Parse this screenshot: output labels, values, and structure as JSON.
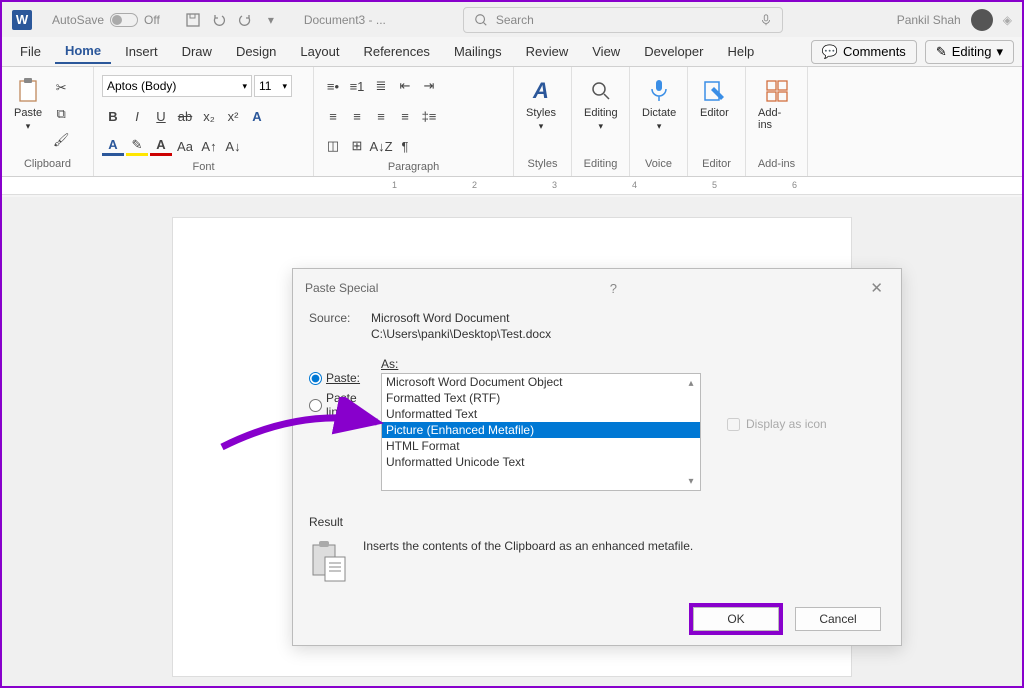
{
  "titlebar": {
    "autosave_label": "AutoSave",
    "autosave_state": "Off",
    "doc_title": "Document3 - ...",
    "search_placeholder": "Search",
    "user_name": "Pankil Shah"
  },
  "tabs": {
    "file": "File",
    "home": "Home",
    "insert": "Insert",
    "draw": "Draw",
    "design": "Design",
    "layout": "Layout",
    "references": "References",
    "mailings": "Mailings",
    "review": "Review",
    "view": "View",
    "developer": "Developer",
    "help": "Help",
    "comments": "Comments",
    "editing": "Editing"
  },
  "ribbon": {
    "clipboard": "Clipboard",
    "paste": "Paste",
    "font_group": "Font",
    "font_name": "Aptos (Body)",
    "font_size": "11",
    "paragraph_group": "Paragraph",
    "styles_group": "Styles",
    "styles": "Styles",
    "editing_group": "Editing",
    "editing": "Editing",
    "voice_group": "Voice",
    "dictate": "Dictate",
    "editor_group": "Editor",
    "editor": "Editor",
    "addins_group": "Add-ins",
    "addins": "Add-ins"
  },
  "ruler": {
    "m1": "1",
    "m2": "2",
    "m3": "3",
    "m4": "4",
    "m5": "5",
    "m6": "6"
  },
  "dialog": {
    "title": "Paste Special",
    "source_label": "Source:",
    "source_line1": "Microsoft Word Document",
    "source_line2": "C:\\Users\\panki\\Desktop\\Test.docx",
    "as_label": "As:",
    "paste_radio": "Paste:",
    "paste_link_radio": "Paste link:",
    "options": {
      "o0": "Microsoft Word Document Object",
      "o1": "Formatted Text (RTF)",
      "o2": "Unformatted Text",
      "o3": "Picture (Enhanced Metafile)",
      "o4": "HTML Format",
      "o5": "Unformatted Unicode Text"
    },
    "display_as_icon": "Display as icon",
    "result_label": "Result",
    "result_text": "Inserts the contents of the Clipboard as an enhanced metafile.",
    "ok": "OK",
    "cancel": "Cancel"
  }
}
